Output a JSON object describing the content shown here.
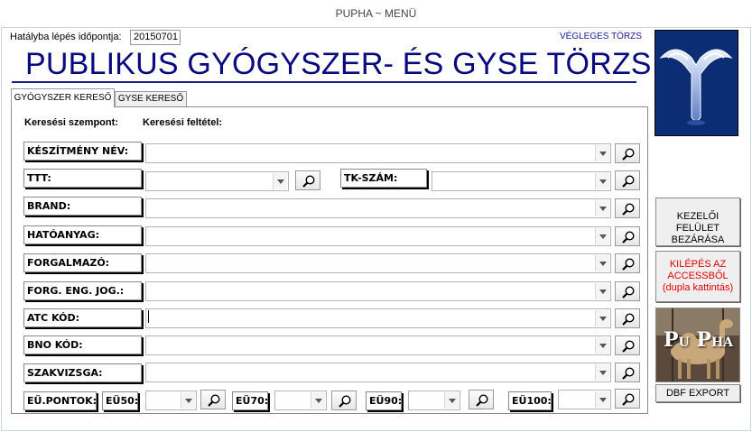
{
  "window": {
    "title": "PUPHA ~ MENÜ"
  },
  "header": {
    "date_label": "Hatályba lépés időpontja:",
    "date_value": "20150701",
    "status": "VÉGLEGES TÖRZS",
    "title": "PUBLIKUS GYÓGYSZER- ÉS GYSE TÖRZS"
  },
  "tabs": [
    {
      "label": "GYÓGYSZER KERESŐ",
      "active": true
    },
    {
      "label": "GYSE KERESŐ",
      "active": false
    }
  ],
  "columns": {
    "criteria": "Keresési szempont:",
    "condition": "Keresési feltétel:"
  },
  "fields": [
    {
      "label": "KÉSZÍTMÉNY NÉV:",
      "value": ""
    },
    {
      "label": "TTT:",
      "value": ""
    },
    {
      "label": "TK-SZÁM:",
      "value": ""
    },
    {
      "label": "BRAND:",
      "value": ""
    },
    {
      "label": "HATÓANYAG:",
      "value": ""
    },
    {
      "label": "FORGALMAZÓ:",
      "value": ""
    },
    {
      "label": "FORG. ENG. JOG.:",
      "value": ""
    },
    {
      "label": "ATC KÓD:",
      "value": ""
    },
    {
      "label": "BNO KÓD:",
      "value": ""
    },
    {
      "label": "SZAKVIZSGA:",
      "value": ""
    }
  ],
  "eu_points": {
    "label": "EÜ.PONTOK:",
    "items": [
      {
        "label": "EÜ50:",
        "value": ""
      },
      {
        "label": "EÜ70:",
        "value": ""
      },
      {
        "label": "EÜ90:",
        "value": ""
      },
      {
        "label": "EÜ100:",
        "value": ""
      }
    ]
  },
  "side_buttons": {
    "close_label": "KEZELŐI FELÜLET BEZÁRÁSA",
    "exit_label": "KILÉPÉS AZ ACCESSBŐL (dupla kattintás)",
    "export_label": "DBF EXPORT",
    "picture_text": [
      "P",
      "U",
      "P",
      "H",
      "A"
    ]
  },
  "colors": {
    "title_blue": "#0a0a80",
    "exit_red": "#e00000",
    "logo_bg": "#0c2d74"
  },
  "icons": {
    "search": "magnifier-icon",
    "dropdown": "chevron-down-icon"
  }
}
